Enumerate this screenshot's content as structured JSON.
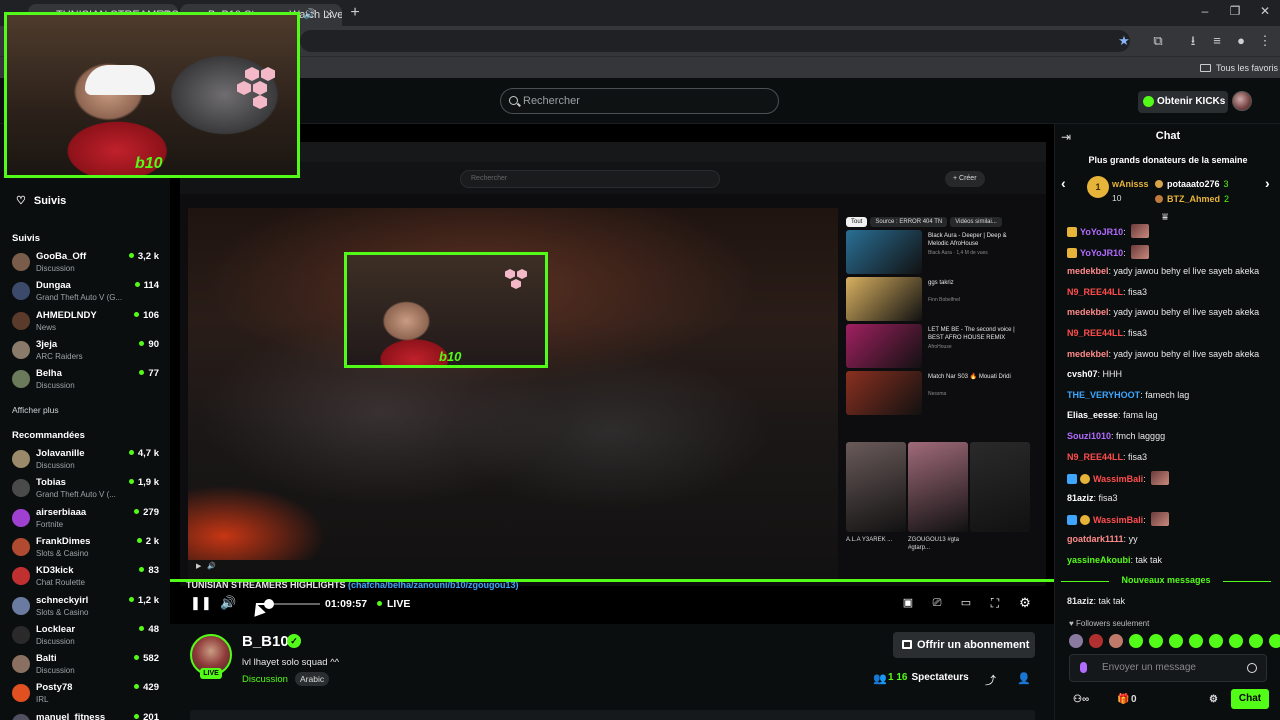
{
  "browser": {
    "tabs": [
      {
        "title": "TUNISIAN STREAMERS HIGHLI..."
      },
      {
        "title": "B_B10 Stream - Watch Live..."
      }
    ],
    "bookmark_folder": "Tous les favoris"
  },
  "header": {
    "search_placeholder": "Rechercher",
    "kicks_label": "Obtenir KICKs"
  },
  "sidebar": {
    "following_label": "Suivis",
    "section_followed": "Suivis",
    "followed": [
      {
        "name": "GooBa_Off",
        "category": "Discussion",
        "viewers": "3,2 k",
        "color": "#7a5c4a"
      },
      {
        "name": "Dungaa",
        "category": "Grand Theft Auto V (G...",
        "viewers": "114",
        "color": "#3b4a6b"
      },
      {
        "name": "AHMEDLNDY",
        "category": "News",
        "viewers": "106",
        "color": "#5a3a2a"
      },
      {
        "name": "3jeja",
        "category": "ARC Raiders",
        "viewers": "90",
        "color": "#8a7a6a"
      },
      {
        "name": "Belha",
        "category": "Discussion",
        "viewers": "77",
        "color": "#6a7a5a"
      }
    ],
    "show_more": "Afficher plus",
    "section_recommended": "Recommandées",
    "recommended": [
      {
        "name": "Jolavanille",
        "category": "Discussion",
        "viewers": "4,7 k",
        "color": "#9a8a6a"
      },
      {
        "name": "Tobias",
        "category": "Grand Theft Auto V (...",
        "viewers": "1,9 k",
        "color": "#4a4a4a"
      },
      {
        "name": "airserbiaaa",
        "category": "Fortnite",
        "viewers": "279",
        "color": "#a040d0"
      },
      {
        "name": "FrankDimes",
        "category": "Slots & Casino",
        "viewers": "2 k",
        "color": "#b04a30"
      },
      {
        "name": "KD3kick",
        "category": "Chat Roulette",
        "viewers": "83",
        "color": "#c03030"
      },
      {
        "name": "schneckyirl",
        "category": "Slots & Casino",
        "viewers": "1,2 k",
        "color": "#6a7aa0"
      },
      {
        "name": "Locklear",
        "category": "Discussion",
        "viewers": "48",
        "color": "#2a2a2a"
      },
      {
        "name": "Balti",
        "category": "Discussion",
        "viewers": "582",
        "color": "#8a7060"
      },
      {
        "name": "Posty78",
        "category": "IRL",
        "viewers": "429",
        "color": "#e05020"
      },
      {
        "name": "manuel_fitness",
        "category": "",
        "viewers": "201",
        "color": "#505060"
      }
    ]
  },
  "player": {
    "overlay_title": "TUNISIAN STREAMERS HIGHLIGHTS",
    "overlay_tags": "(chafcha/belha/zanouni/b10/zgougou13)",
    "time": "01:09:57",
    "live_label": "LIVE",
    "progress_percent": 100,
    "volume_percent": 20,
    "inner": {
      "search": "Rechercher",
      "create": "+ Créer",
      "tags": [
        "Tout",
        "Source : ERROR 404 TN",
        "Vidéos similai..."
      ],
      "recs": [
        {
          "title": "Black Aura - Deeper | Deep & Melodic AfroHouse",
          "meta": "Black Aura · 1,4 M de vues",
          "color": "#2a6f95"
        },
        {
          "title": "ggs takriz",
          "meta": "Finn Bobelfnel",
          "color": "#d8b060"
        },
        {
          "title": "LET ME BE - The second voice | BEST AFRO HOUSE REMIX",
          "meta": "AfroHouse",
          "color": "#a02060"
        },
        {
          "title": "Match Nar S03 🔥 Mouati Dridi",
          "meta": "Nessma",
          "color": "#8a3020"
        }
      ],
      "shorts": [
        {
          "title": "A.L.A Y3AREK ...",
          "color": "#6a5a5a"
        },
        {
          "title": "ZGOUGOU13 #gta #gtarp...",
          "color": "#a06a7a"
        },
        {
          "title": "...",
          "color": "#2a2a2a"
        }
      ]
    }
  },
  "streamer": {
    "name": "B_B10",
    "live_badge": "LIVE",
    "title": "lvl lhayet solo squad ^^",
    "category": "Discussion",
    "language": "Arabic",
    "subscribe_label": "Offrir un abonnement",
    "viewers": "1 16",
    "viewers_label": "Spectateurs"
  },
  "chat": {
    "title": "Chat",
    "donors_title": "Plus grands donateurs de la semaine",
    "top_donor": {
      "rank": "1",
      "name": "wAnisss",
      "amount": "10"
    },
    "donors": [
      {
        "name": "potaaato276",
        "amount": "3",
        "color": "#ffffff"
      },
      {
        "name": "BTZ_Ahmed",
        "amount": "2",
        "color": "#e7b43a"
      }
    ],
    "messages": [
      {
        "user": "YoYoJR10",
        "text": "",
        "color": "#b26bff",
        "emote": true
      },
      {
        "user": "YoYoJR10",
        "text": "",
        "color": "#b26bff",
        "emote": true
      },
      {
        "user": "medekbel",
        "text": "yady jawou behy el live sayeb akeka",
        "color": "#ff8a8a"
      },
      {
        "user": "N9_REE44LL",
        "text": "fisa3",
        "color": "#ff4d4d"
      },
      {
        "user": "medekbel",
        "text": "yady jawou behy el live sayeb akeka",
        "color": "#ff8a8a"
      },
      {
        "user": "N9_REE44LL",
        "text": "fisa3",
        "color": "#ff4d4d"
      },
      {
        "user": "medekbel",
        "text": "yady jawou behy el live sayeb akeka",
        "color": "#ff8a8a"
      },
      {
        "user": "cvsh07",
        "text": "HHH",
        "color": "#ffffff"
      },
      {
        "user": "THE_VERYHOOT",
        "text": "famech lag",
        "color": "#3ea6ff"
      },
      {
        "user": "Elias_eesse",
        "text": "fama lag",
        "color": "#ffffff"
      },
      {
        "user": "Souzi1010",
        "text": "fmch lagggg",
        "color": "#b26bff"
      },
      {
        "user": "N9_REE44LL",
        "text": "fisa3",
        "color": "#ff4d4d"
      },
      {
        "user": "WassimBali",
        "text": "",
        "color": "#ff4d4d",
        "badges": true,
        "emote": true
      },
      {
        "user": "81aziz",
        "text": "fisa3",
        "color": "#ffffff"
      },
      {
        "user": "WassimBali",
        "text": "",
        "color": "#ff4d4d",
        "badges": true,
        "emote": true
      },
      {
        "user": "goatdark1111",
        "text": "yy",
        "color": "#ff8a8a"
      },
      {
        "user": "yassineAkoubi",
        "text": "tak tak",
        "color": "#53fc18"
      }
    ],
    "new_messages_label": "Nouveaux messages",
    "last_message": {
      "user": "81aziz",
      "text": "tak tak"
    },
    "followers_only": "Followers seulement",
    "input_placeholder": "Envoyer un message",
    "kicks_count": "0",
    "send_label": "Chat"
  }
}
